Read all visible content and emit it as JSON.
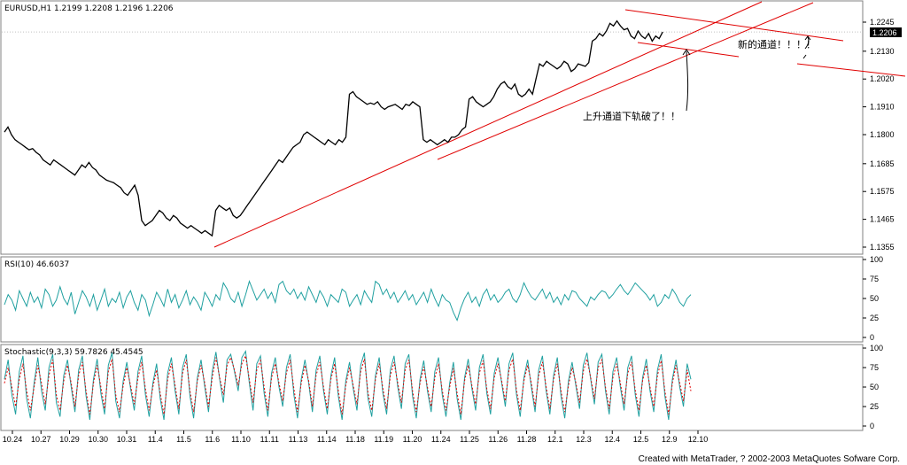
{
  "chart_data": [
    {
      "type": "line",
      "title": "EURUSD,H1",
      "ohlc": "1.2199 1.2208 1.2196 1.2206",
      "current_price_label": "1.2206",
      "current_price": 1.2206,
      "y_ticks": [
        "1.2245",
        "1.2130",
        "1.2020",
        "1.1910",
        "1.1800",
        "1.1685",
        "1.1575",
        "1.1465",
        "1.1355"
      ],
      "ylim": [
        1.1355,
        1.2245
      ],
      "x": [
        0,
        4,
        8,
        12,
        16,
        20,
        24,
        28,
        32,
        36,
        40,
        44,
        48,
        52,
        56,
        60,
        64,
        68,
        72,
        76,
        80,
        84,
        88,
        92,
        96,
        100,
        104,
        108,
        112,
        116,
        120,
        124,
        128,
        132,
        136,
        140,
        144,
        148,
        152,
        156,
        160,
        164,
        168,
        172,
        176,
        180,
        184,
        188,
        192,
        196,
        200,
        204,
        208,
        212,
        216,
        220,
        224,
        228,
        232,
        236,
        240,
        244,
        248,
        252,
        256,
        260,
        264,
        268,
        272,
        276,
        280,
        284,
        288,
        292,
        296,
        300,
        304,
        308,
        312,
        316,
        320,
        324,
        328,
        332,
        336,
        340,
        344,
        348,
        352,
        356,
        360,
        364,
        368,
        372,
        376,
        380,
        384,
        388,
        392,
        396,
        400,
        404,
        408,
        412,
        416,
        420,
        424,
        428,
        432,
        436,
        440,
        444,
        448,
        452,
        456,
        460,
        464,
        468,
        472,
        476,
        480,
        484,
        488,
        492,
        496,
        500,
        504,
        508,
        512,
        516,
        520,
        524,
        528,
        532,
        536,
        540,
        544,
        548,
        552,
        556,
        560,
        564,
        568,
        572,
        576,
        580,
        584,
        588,
        592,
        596,
        600,
        604,
        608,
        612,
        616,
        620,
        624,
        628,
        632,
        636,
        640,
        644,
        648,
        652,
        656,
        660,
        664,
        668,
        672,
        676,
        680,
        684,
        688,
        692,
        696,
        700,
        704,
        708,
        712,
        716,
        720,
        724,
        728,
        732,
        736,
        740,
        744,
        748,
        752,
        756,
        760,
        764,
        768,
        772,
        776,
        780
      ],
      "series": [
        {
          "values": [
            1.181,
            1.183,
            1.18,
            1.178,
            1.177,
            1.176,
            1.175,
            1.174,
            1.1745,
            1.173,
            1.172,
            1.17,
            1.169,
            1.168,
            1.17,
            1.169,
            1.168,
            1.167,
            1.166,
            1.165,
            1.164,
            1.166,
            1.168,
            1.167,
            1.169,
            1.167,
            1.166,
            1.164,
            1.163,
            1.162,
            1.1615,
            1.161,
            1.16,
            1.159,
            1.157,
            1.156,
            1.158,
            1.16,
            1.156,
            1.146,
            1.144,
            1.145,
            1.146,
            1.148,
            1.15,
            1.149,
            1.147,
            1.146,
            1.148,
            1.147,
            1.145,
            1.144,
            1.143,
            1.144,
            1.143,
            1.142,
            1.141,
            1.142,
            1.141,
            1.14,
            1.15,
            1.152,
            1.151,
            1.15,
            1.151,
            1.148,
            1.147,
            1.148,
            1.15,
            1.152,
            1.154,
            1.156,
            1.158,
            1.16,
            1.162,
            1.164,
            1.166,
            1.168,
            1.17,
            1.169,
            1.171,
            1.173,
            1.175,
            1.176,
            1.177,
            1.18,
            1.181,
            1.18,
            1.179,
            1.178,
            1.177,
            1.176,
            1.178,
            1.177,
            1.176,
            1.178,
            1.177,
            1.179,
            1.196,
            1.197,
            1.195,
            1.194,
            1.193,
            1.192,
            1.1925,
            1.192,
            1.193,
            1.191,
            1.19,
            1.191,
            1.1915,
            1.192,
            1.191,
            1.19,
            1.192,
            1.1915,
            1.193,
            1.192,
            1.191,
            1.178,
            1.177,
            1.178,
            1.177,
            1.176,
            1.177,
            1.178,
            1.177,
            1.179,
            1.179,
            1.18,
            1.182,
            1.183,
            1.194,
            1.195,
            1.193,
            1.192,
            1.191,
            1.192,
            1.193,
            1.195,
            1.198,
            1.2,
            1.201,
            1.199,
            1.198,
            1.2,
            1.196,
            1.195,
            1.196,
            1.198,
            1.196,
            1.202,
            1.208,
            1.207,
            1.209,
            1.208,
            1.207,
            1.206,
            1.207,
            1.209,
            1.208,
            1.205,
            1.206,
            1.208,
            1.2075,
            1.207,
            1.2085,
            1.217,
            1.218,
            1.22,
            1.219,
            1.221,
            1.224,
            1.223,
            1.225,
            1.223,
            1.2215,
            1.222,
            1.219,
            1.218,
            1.221,
            1.219,
            1.218,
            1.22,
            1.217,
            1.219,
            1.218,
            1.2206
          ]
        }
      ],
      "annotations": [
        "新的通道！！！！",
        "上升通道下轨破了！！"
      ]
    },
    {
      "type": "line",
      "title": "RSI(10)",
      "value_label": "46.6037",
      "y_ticks": [
        "100",
        "75",
        "50",
        "25",
        "0"
      ],
      "ylim": [
        0,
        100
      ],
      "series": [
        {
          "values": [
            42,
            55,
            48,
            35,
            60,
            50,
            40,
            58,
            45,
            52,
            38,
            62,
            55,
            40,
            48,
            65,
            50,
            42,
            58,
            30,
            45,
            60,
            52,
            40,
            55,
            35,
            48,
            62,
            40,
            50,
            45,
            58,
            38,
            52,
            60,
            45,
            35,
            55,
            48,
            28,
            42,
            58,
            50,
            40,
            62,
            45,
            55,
            38,
            48,
            60,
            42,
            52,
            45,
            35,
            58,
            50,
            40,
            55,
            48,
            70,
            62,
            50,
            45,
            58,
            40,
            55,
            72,
            60,
            48,
            55,
            62,
            50,
            58,
            45,
            68,
            72,
            60,
            55,
            62,
            50,
            58,
            48,
            65,
            55,
            45,
            60,
            52,
            40,
            55,
            50,
            45,
            62,
            58,
            40,
            48,
            55,
            42,
            60,
            52,
            45,
            72,
            68,
            55,
            62,
            50,
            58,
            45,
            52,
            60,
            48,
            55,
            42,
            50,
            58,
            45,
            62,
            50,
            40,
            55,
            48,
            45,
            32,
            22,
            38,
            50,
            58,
            45,
            52,
            40,
            55,
            62,
            48,
            55,
            45,
            50,
            58,
            62,
            50,
            45,
            55,
            70,
            60,
            52,
            48,
            55,
            62,
            50,
            58,
            45,
            52,
            42,
            55,
            48,
            60,
            58,
            50,
            45,
            40,
            52,
            48,
            55,
            60,
            58,
            50,
            55,
            62,
            68,
            60,
            55,
            62,
            70,
            65,
            60,
            55,
            48,
            55,
            40,
            45,
            55,
            50,
            62,
            55,
            45,
            40,
            50,
            55
          ]
        }
      ]
    },
    {
      "type": "line",
      "title": "Stochastic(9,3,3)",
      "value_label": "59.7826 45.4545",
      "y_ticks": [
        "100",
        "75",
        "50",
        "25",
        "0"
      ],
      "ylim": [
        0,
        100
      ],
      "series": [
        {
          "values": [
            60,
            85,
            40,
            15,
            70,
            90,
            35,
            10,
            55,
            88,
            45,
            20,
            75,
            92,
            30,
            12,
            65,
            85,
            50,
            18,
            72,
            90,
            38,
            8,
            60,
            86,
            42,
            15,
            78,
            94,
            32,
            10,
            58,
            82,
            48,
            20,
            70,
            90,
            40,
            12,
            55,
            80,
            35,
            8,
            68,
            88,
            45,
            15,
            75,
            92,
            38,
            10,
            62,
            85,
            50,
            18,
            70,
            95,
            60,
            30,
            85,
            92,
            70,
            45,
            88,
            96,
            55,
            20,
            80,
            90,
            42,
            12,
            68,
            88,
            50,
            25,
            75,
            92,
            40,
            10,
            60,
            85,
            55,
            18,
            72,
            90,
            45,
            15,
            65,
            88,
            38,
            8,
            58,
            82,
            48,
            20,
            78,
            94,
            35,
            12,
            65,
            88,
            42,
            15,
            72,
            90,
            50,
            22,
            80,
            92,
            38,
            10,
            60,
            84,
            45,
            18,
            70,
            88,
            40,
            12,
            55,
            82,
            35,
            8,
            62,
            86,
            48,
            20,
            75,
            92,
            42,
            15,
            68,
            88,
            55,
            25,
            80,
            94,
            40,
            12,
            62,
            85,
            50,
            18,
            72,
            90,
            45,
            15,
            65,
            88,
            38,
            10,
            58,
            82,
            52,
            22,
            78,
            94,
            60,
            28,
            82,
            92,
            45,
            15,
            70,
            88,
            50,
            20,
            75,
            90,
            40,
            12,
            62,
            86,
            45,
            18,
            72,
            92,
            38,
            8,
            60,
            85,
            50,
            25,
            80,
            60
          ]
        },
        {
          "values": [
            55,
            75,
            50,
            25,
            60,
            80,
            45,
            20,
            50,
            78,
            55,
            28,
            65,
            85,
            40,
            20,
            58,
            78,
            55,
            25,
            65,
            82,
            45,
            15,
            55,
            78,
            50,
            22,
            70,
            86,
            40,
            18,
            52,
            75,
            52,
            28,
            62,
            82,
            48,
            20,
            50,
            72,
            42,
            15,
            60,
            80,
            52,
            22,
            68,
            85,
            45,
            18,
            58,
            78,
            55,
            25,
            62,
            88,
            62,
            40,
            78,
            88,
            72,
            52,
            80,
            90,
            60,
            30,
            72,
            84,
            50,
            20,
            62,
            80,
            55,
            32,
            68,
            85,
            48,
            18,
            55,
            78,
            58,
            25,
            65,
            82,
            50,
            22,
            60,
            80,
            45,
            15,
            52,
            75,
            52,
            28,
            70,
            86,
            42,
            20,
            60,
            80,
            48,
            22,
            65,
            82,
            55,
            30,
            72,
            85,
            45,
            18,
            55,
            76,
            50,
            25,
            62,
            80,
            46,
            20,
            50,
            74,
            42,
            15,
            58,
            78,
            52,
            28,
            68,
            84,
            48,
            22,
            62,
            80,
            58,
            32,
            72,
            86,
            46,
            20,
            58,
            78,
            55,
            25,
            65,
            82,
            50,
            22,
            60,
            80,
            45,
            18,
            52,
            75,
            56,
            30,
            70,
            86,
            62,
            35,
            75,
            85,
            50,
            22,
            62,
            80,
            55,
            28,
            68,
            82,
            46,
            20,
            58,
            78,
            50,
            25,
            65,
            84,
            45,
            15,
            55,
            78,
            55,
            32,
            72,
            45
          ]
        }
      ]
    },
    {
      "type": "line",
      "x_ticks": [
        "10.24",
        "10.27",
        "10.29",
        "10.30",
        "10.31",
        "11.4",
        "11.5",
        "11.6",
        "11.10",
        "11.11",
        "11.13",
        "11.14",
        "11.18",
        "11.19",
        "11.20",
        "11.24",
        "11.25",
        "11.26",
        "11.28",
        "12.1",
        "12.3",
        "12.4",
        "12.5",
        "12.9",
        "12.10"
      ],
      "credit": "Created with MetaTrader, ? 2002-2003 MetaQuotes Sofware Corp."
    }
  ]
}
